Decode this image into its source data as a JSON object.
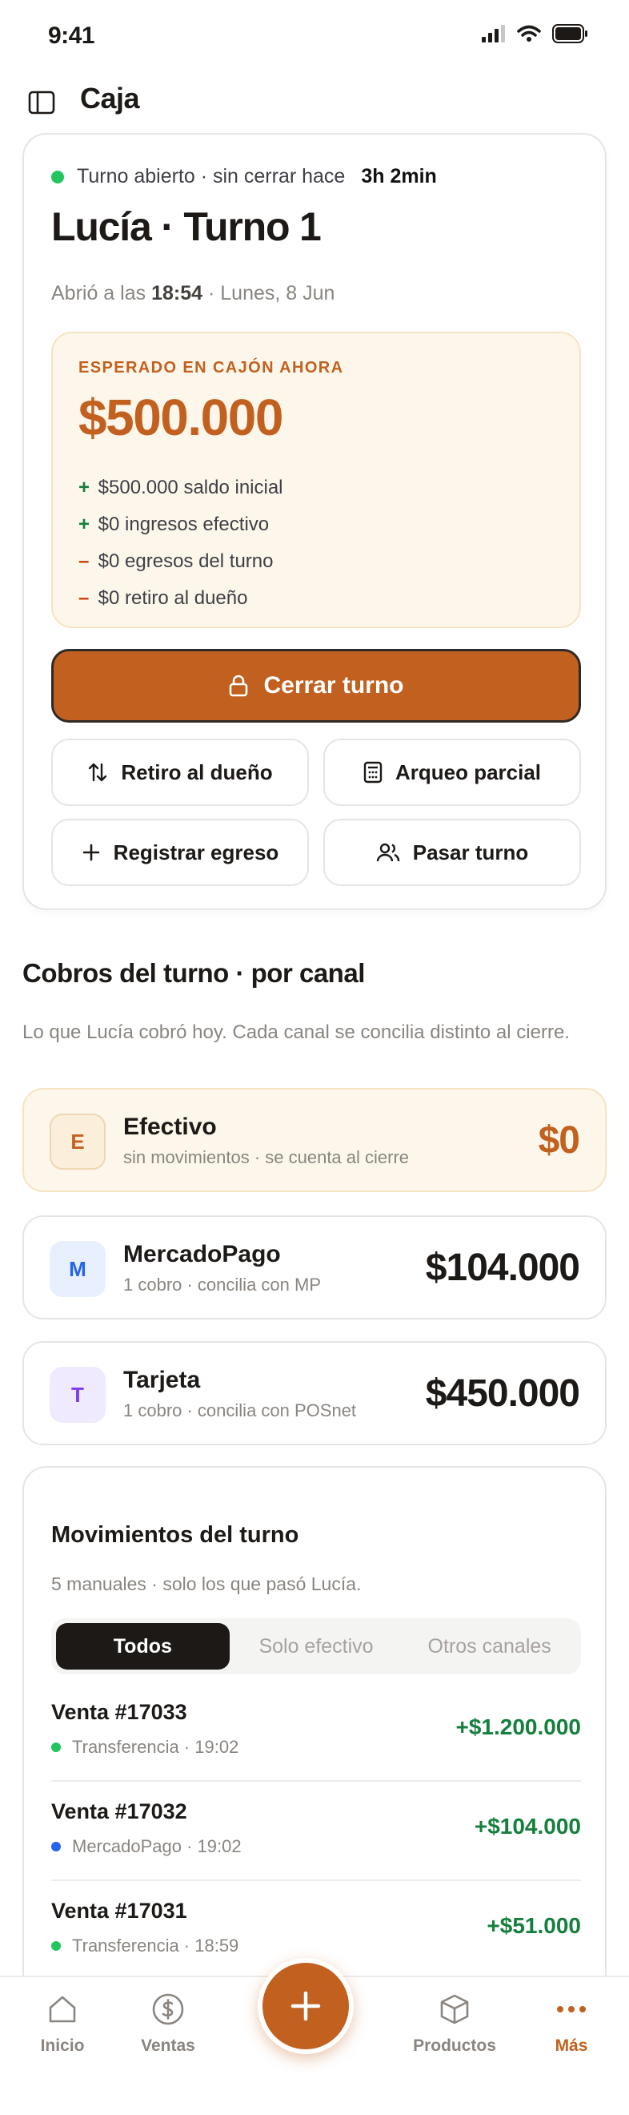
{
  "status_bar": {
    "time": "9:41"
  },
  "header": {
    "title": "Caja"
  },
  "shift": {
    "status": "Turno abierto · sin cerrar hace",
    "duration": "3h 2min",
    "title": "Lucía · Turno 1",
    "opened_prefix": "Abrió a las",
    "opened_time": "18:54",
    "opened_suffix": "· Lunes, 8 Jun",
    "expected_label": "ESPERADO EN CAJÓN AHORA",
    "expected_amount": "$500.000",
    "breakdown": [
      {
        "sign": "+",
        "text": "$500.000 saldo inicial"
      },
      {
        "sign": "+",
        "text": "$0 ingresos efectivo"
      },
      {
        "sign": "–",
        "text": "$0 egresos del turno"
      },
      {
        "sign": "–",
        "text": "$0 retiro al dueño"
      }
    ],
    "close_button": "Cerrar turno",
    "actions": {
      "withdraw": "Retiro al dueño",
      "partial_count": "Arqueo parcial",
      "register_expense": "Registrar egreso",
      "handover": "Pasar turno"
    }
  },
  "channels_section": {
    "title": "Cobros del turno · por canal",
    "subtitle": "Lo que Lucía cobró hoy. Cada canal se concilia distinto al cierre.",
    "items": [
      {
        "badge": "E",
        "name": "Efectivo",
        "meta": "sin movimientos · se cuenta al cierre",
        "amount": "$0"
      },
      {
        "badge": "M",
        "name": "MercadoPago",
        "meta": "1 cobro · concilia con MP",
        "amount": "$104.000"
      },
      {
        "badge": "T",
        "name": "Tarjeta",
        "meta": "1 cobro · concilia con POSnet",
        "amount": "$450.000"
      }
    ]
  },
  "movements": {
    "title": "Movimientos del turno",
    "subtitle": "5 manuales · solo los que pasó Lucía.",
    "tabs": [
      "Todos",
      "Solo efectivo",
      "Otros canales"
    ],
    "active_tab": "Todos",
    "rows": [
      {
        "name": "Venta #17033",
        "meta": "Transferencia · 19:02",
        "amount": "+$1.200.000",
        "dot_color": "#22c55e"
      },
      {
        "name": "Venta #17032",
        "meta": "MercadoPago · 19:02",
        "amount": "+$104.000",
        "dot_color": "#2563eb"
      },
      {
        "name": "Venta #17031",
        "meta": "Transferencia · 18:59",
        "amount": "+$51.000",
        "dot_color": "#22c55e"
      }
    ]
  },
  "bottom_nav": {
    "items": [
      {
        "label": "Inicio",
        "icon": "home-icon"
      },
      {
        "label": "Ventas",
        "icon": "dollar-icon"
      },
      {
        "label": "Productos",
        "icon": "box-icon"
      },
      {
        "label": "Más",
        "icon": "more-icon"
      }
    ],
    "active": "Más",
    "fab_icon": "plus-icon"
  },
  "colors": {
    "accent": "#c2611f",
    "positive": "#15803d",
    "negative": "#c2410c",
    "status_green": "#22c55e"
  }
}
